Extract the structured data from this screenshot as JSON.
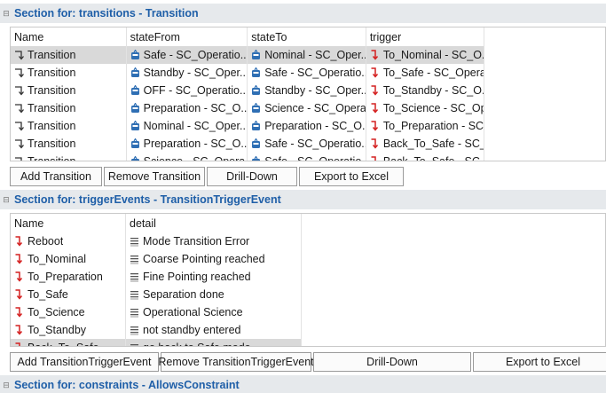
{
  "sections": [
    {
      "title": "Section for: transitions - Transition"
    },
    {
      "title": "Section for: triggerEvents - TransitionTriggerEvent"
    },
    {
      "title": "Section for: constraints - AllowsConstraint"
    }
  ],
  "transitions": {
    "headers": [
      "Name",
      "stateFrom",
      "stateTo",
      "trigger"
    ],
    "rows": [
      [
        "Transition",
        "Safe - SC_Operatio...",
        "Nominal - SC_Oper...",
        "To_Nominal - SC_O..."
      ],
      [
        "Transition",
        "Standby - SC_Oper...",
        "Safe - SC_Operatio...",
        "To_Safe - SC_Opera..."
      ],
      [
        "Transition",
        "OFF - SC_Operatio...",
        "Standby - SC_Oper...",
        "To_Standby - SC_O..."
      ],
      [
        "Transition",
        "Preparation - SC_O...",
        "Science - SC_Opera...",
        "To_Science - SC_Op..."
      ],
      [
        "Transition",
        "Nominal - SC_Oper...",
        "Preparation - SC_O...",
        "To_Preparation - SC..."
      ],
      [
        "Transition",
        "Preparation - SC_O...",
        "Safe - SC_Operatio...",
        "Back_To_Safe - SC_..."
      ],
      [
        "Transition",
        "Science - SC_Opera...",
        "Safe - SC_Operatio...",
        "Back_To_Safe - SC_..."
      ]
    ],
    "selected_row": 0,
    "buttons": [
      "Add Transition",
      "Remove Transition",
      "Drill-Down",
      "Export to Excel"
    ]
  },
  "trigger_events": {
    "headers": [
      "Name",
      "detail"
    ],
    "rows": [
      [
        "Reboot",
        "Mode Transition Error"
      ],
      [
        "To_Nominal",
        "Coarse Pointing reached"
      ],
      [
        "To_Preparation",
        "Fine Pointing reached"
      ],
      [
        "To_Safe",
        "Separation done"
      ],
      [
        "To_Science",
        "Operational Science"
      ],
      [
        "To_Standby",
        "not standby entered"
      ],
      [
        "Back_To_Safe",
        "go back to Safe mode"
      ]
    ],
    "selected_row": 6,
    "buttons": [
      "Add TransitionTriggerEvent",
      "Remove TransitionTriggerEvent",
      "Drill-Down",
      "Export to Excel"
    ]
  },
  "colors": {
    "section_header_bg": "#e6e9ec",
    "section_title": "#1f5fa8",
    "selected_row": "#d9d9d9",
    "state_icon": "#2f6fb4",
    "trigger_icon": "#d42020"
  },
  "icons": {
    "transition": "transition-arrow-icon",
    "state": "state-icon",
    "trigger": "trigger-event-icon",
    "detail": "text-detail-icon",
    "section_toggle": "collapse-toggle-icon"
  }
}
